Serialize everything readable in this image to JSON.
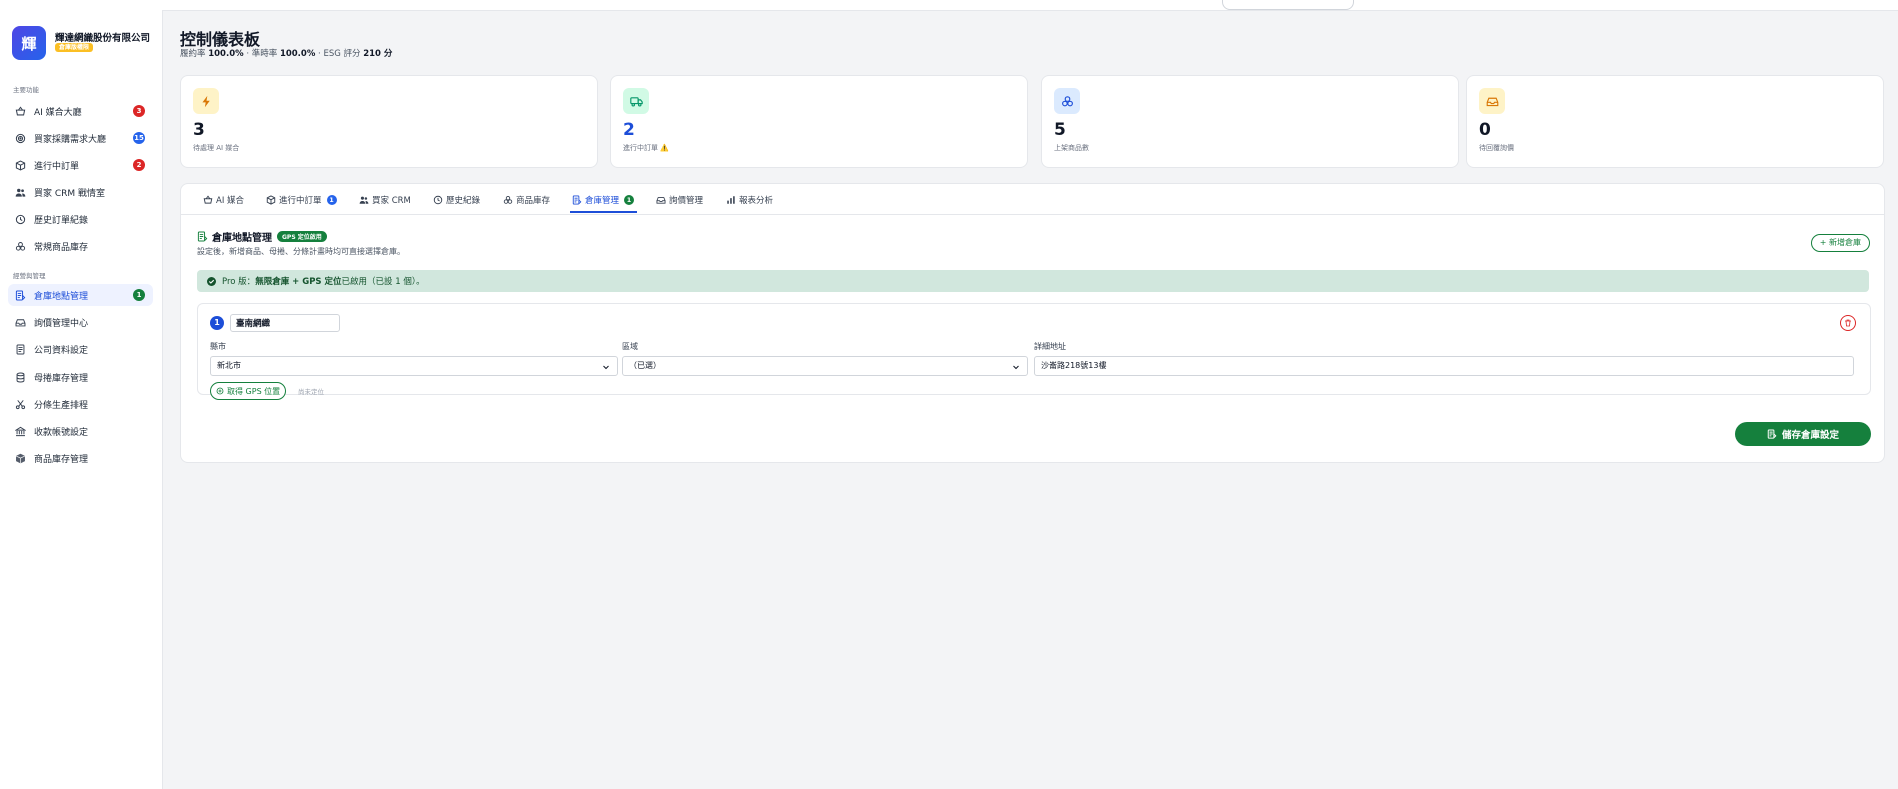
{
  "brand": {
    "logo_char": "輝",
    "company": "輝達網織股份有限公司",
    "badge": "倉庫版權限"
  },
  "sidebar": {
    "section_main": "主要功能",
    "section_settings": "經營與管理",
    "main_items": [
      {
        "label": "AI 媒合大廳",
        "badge": "3",
        "icon": "basket-icon"
      },
      {
        "label": "買家採購需求大廳",
        "badge": "15",
        "icon": "target-icon"
      },
      {
        "label": "進行中訂單",
        "badge": "2",
        "icon": "box-icon"
      },
      {
        "label": "買家 CRM 戰情室",
        "badge": "",
        "icon": "users-icon"
      },
      {
        "label": "歷史訂單紀錄",
        "badge": "",
        "icon": "clock-icon"
      },
      {
        "label": "常規商品庫存",
        "badge": "",
        "icon": "boxes-icon"
      }
    ],
    "settings_items": [
      {
        "label": "倉庫地點管理",
        "badge": "1",
        "icon": "warehouse-doc-icon"
      },
      {
        "label": "詢價管理中心",
        "badge": "",
        "icon": "inbox-icon"
      },
      {
        "label": "公司資料設定",
        "badge": "",
        "icon": "building-doc-icon"
      },
      {
        "label": "母捲庫存管理",
        "badge": "",
        "icon": "cylinder-icon"
      },
      {
        "label": "分條生產排程",
        "badge": "",
        "icon": "scissors-icon"
      },
      {
        "label": "收款帳號設定",
        "badge": "",
        "icon": "bank-icon"
      },
      {
        "label": "商品庫存管理",
        "badge": "",
        "icon": "package-icon"
      }
    ]
  },
  "header": {
    "title": "控制儀表板",
    "stats_line": {
      "fulfill_label": "履約率",
      "fulfill_value": "100.0%",
      "ontime_label": "· 準時率",
      "ontime_value": "100.0%",
      "esg_label": "· ESG 評分",
      "esg_value": "210 分"
    }
  },
  "stats": [
    {
      "value": "3",
      "label": "待處理 AI 媒合",
      "icon": "bolt-icon"
    },
    {
      "value": "2",
      "label": "進行中訂單 ⚠️",
      "icon": "truck-icon"
    },
    {
      "value": "5",
      "label": "上架商品數",
      "icon": "boxes-icon"
    },
    {
      "value": "0",
      "label": "待回覆詢價",
      "icon": "inbox-icon"
    }
  ],
  "tabs": [
    {
      "label": "AI 媒合",
      "badge": ""
    },
    {
      "label": "進行中訂單",
      "badge": "1"
    },
    {
      "label": "買家 CRM",
      "badge": ""
    },
    {
      "label": "歷史紀錄",
      "badge": ""
    },
    {
      "label": "商品庫存",
      "badge": ""
    },
    {
      "label": "倉庫管理",
      "badge": "1"
    },
    {
      "label": "詢價管理",
      "badge": ""
    },
    {
      "label": "報表分析",
      "badge": ""
    }
  ],
  "warehouse": {
    "title": "倉庫地點管理",
    "gps_badge": "GPS 定位啟用",
    "description": "設定後，新增商品、母捲、分條計畫時均可直接選擇倉庫。",
    "add_button": "+ 新增倉庫",
    "pro_prefix": "Pro 版：",
    "pro_bold": "無限倉庫 + GPS 定位",
    "pro_suffix": "已啟用（已設 1 個）。",
    "card": {
      "index": "1",
      "name": "臺南網織",
      "city_label": "縣市",
      "city_value": "新北市",
      "district_label": "區域",
      "district_value": "（已選）",
      "address_label": "詳細地址",
      "address_value": "沙崙路218號13樓",
      "gps_button": "取得 GPS 位置",
      "gps_status": "尚未定位"
    },
    "save_button": "儲存倉庫設定"
  },
  "colors": {
    "primary": "#1d4ed8",
    "success": "#15803d",
    "danger": "#dc2626",
    "pro_bg": "#d1e7dd"
  }
}
